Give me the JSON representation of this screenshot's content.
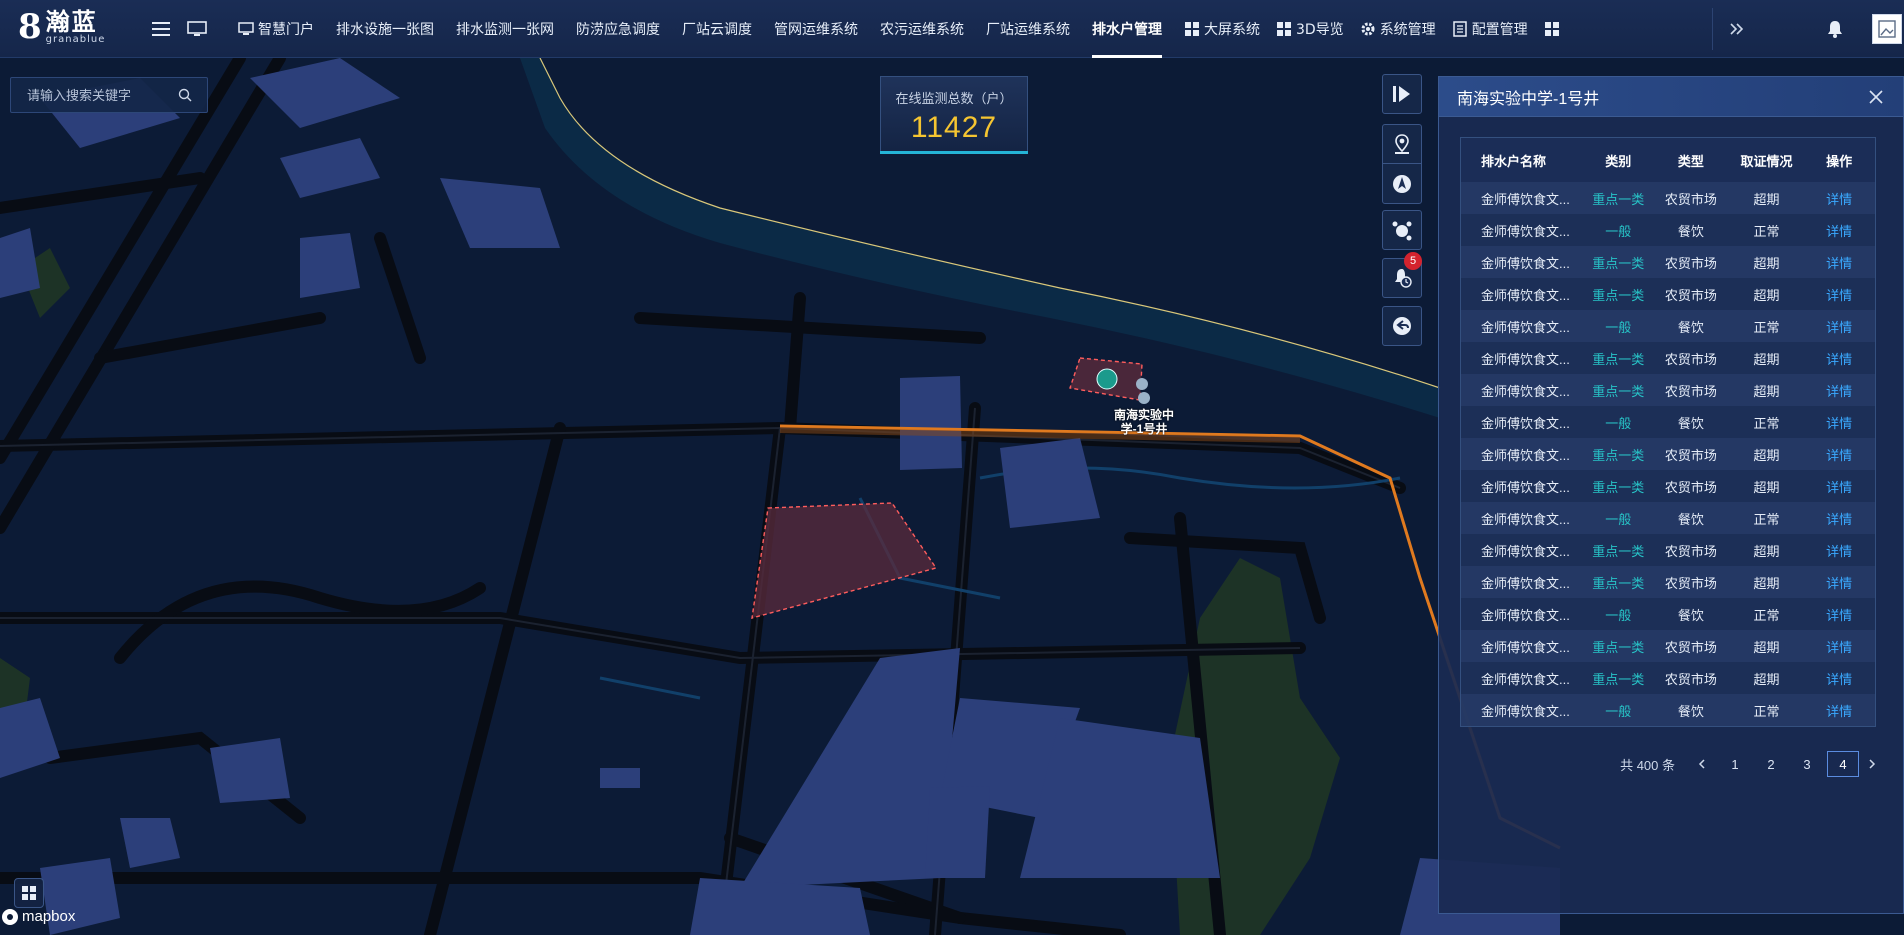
{
  "app": {
    "logo_mark": "8",
    "logo_cn": "瀚蓝",
    "logo_en": "granablue"
  },
  "nav": [
    {
      "label": "智慧门户",
      "icon": "monitor-icon"
    },
    {
      "label": "排水设施一张图",
      "icon": ""
    },
    {
      "label": "排水监测一张网",
      "icon": ""
    },
    {
      "label": "防涝应急调度",
      "icon": ""
    },
    {
      "label": "厂站云调度",
      "icon": ""
    },
    {
      "label": "管网运维系统",
      "icon": ""
    },
    {
      "label": "农污运维系统",
      "icon": ""
    },
    {
      "label": "厂站运维系统",
      "icon": ""
    },
    {
      "label": "排水户管理",
      "icon": "",
      "active": true
    },
    {
      "label": "大屏系统",
      "icon": "grid-icon"
    },
    {
      "label": "3D导览",
      "icon": "grid-icon"
    },
    {
      "label": "系统管理",
      "icon": "gear-icon"
    },
    {
      "label": "配置管理",
      "icon": "document-icon"
    },
    {
      "label": "",
      "icon": "grid-icon"
    }
  ],
  "search": {
    "placeholder": "请输入搜索关键字"
  },
  "stat": {
    "label": "在线监测总数（户）",
    "value": "11427"
  },
  "tools": {
    "alarm_count": "5"
  },
  "map": {
    "marker_label": "南海实验中学-1号井"
  },
  "panel": {
    "title": "南海实验中学-1号井",
    "columns": [
      "排水户名称",
      "类别",
      "类型",
      "取证情况",
      "操作"
    ],
    "rows": [
      {
        "name": "金师傅饮食文...",
        "category": "重点一类",
        "type": "农贸市场",
        "license": "超期",
        "action": "详情"
      },
      {
        "name": "金师傅饮食文...",
        "category": "一般",
        "type": "餐饮",
        "license": "正常",
        "action": "详情"
      },
      {
        "name": "金师傅饮食文...",
        "category": "重点一类",
        "type": "农贸市场",
        "license": "超期",
        "action": "详情"
      },
      {
        "name": "金师傅饮食文...",
        "category": "重点一类",
        "type": "农贸市场",
        "license": "超期",
        "action": "详情"
      },
      {
        "name": "金师傅饮食文...",
        "category": "一般",
        "type": "餐饮",
        "license": "正常",
        "action": "详情"
      },
      {
        "name": "金师傅饮食文...",
        "category": "重点一类",
        "type": "农贸市场",
        "license": "超期",
        "action": "详情"
      },
      {
        "name": "金师傅饮食文...",
        "category": "重点一类",
        "type": "农贸市场",
        "license": "超期",
        "action": "详情"
      },
      {
        "name": "金师傅饮食文...",
        "category": "一般",
        "type": "餐饮",
        "license": "正常",
        "action": "详情"
      },
      {
        "name": "金师傅饮食文...",
        "category": "重点一类",
        "type": "农贸市场",
        "license": "超期",
        "action": "详情"
      },
      {
        "name": "金师傅饮食文...",
        "category": "重点一类",
        "type": "农贸市场",
        "license": "超期",
        "action": "详情"
      },
      {
        "name": "金师傅饮食文...",
        "category": "一般",
        "type": "餐饮",
        "license": "正常",
        "action": "详情"
      },
      {
        "name": "金师傅饮食文...",
        "category": "重点一类",
        "type": "农贸市场",
        "license": "超期",
        "action": "详情"
      },
      {
        "name": "金师傅饮食文...",
        "category": "重点一类",
        "type": "农贸市场",
        "license": "超期",
        "action": "详情"
      },
      {
        "name": "金师傅饮食文...",
        "category": "一般",
        "type": "餐饮",
        "license": "正常",
        "action": "详情"
      },
      {
        "name": "金师傅饮食文...",
        "category": "重点一类",
        "type": "农贸市场",
        "license": "超期",
        "action": "详情"
      },
      {
        "name": "金师傅饮食文...",
        "category": "重点一类",
        "type": "农贸市场",
        "license": "超期",
        "action": "详情"
      },
      {
        "name": "金师傅饮食文...",
        "category": "一般",
        "type": "餐饮",
        "license": "正常",
        "action": "详情"
      }
    ],
    "pagination": {
      "total": "共 400 条",
      "pages": [
        "1",
        "2",
        "3",
        "4"
      ],
      "current": "4"
    }
  },
  "attribution": "mapbox",
  "colors": {
    "accent": "#27c3c7",
    "link": "#3aa9ff",
    "highlight": "#f5c531",
    "route": "#e07a1f",
    "alarm": "#d4232e"
  }
}
